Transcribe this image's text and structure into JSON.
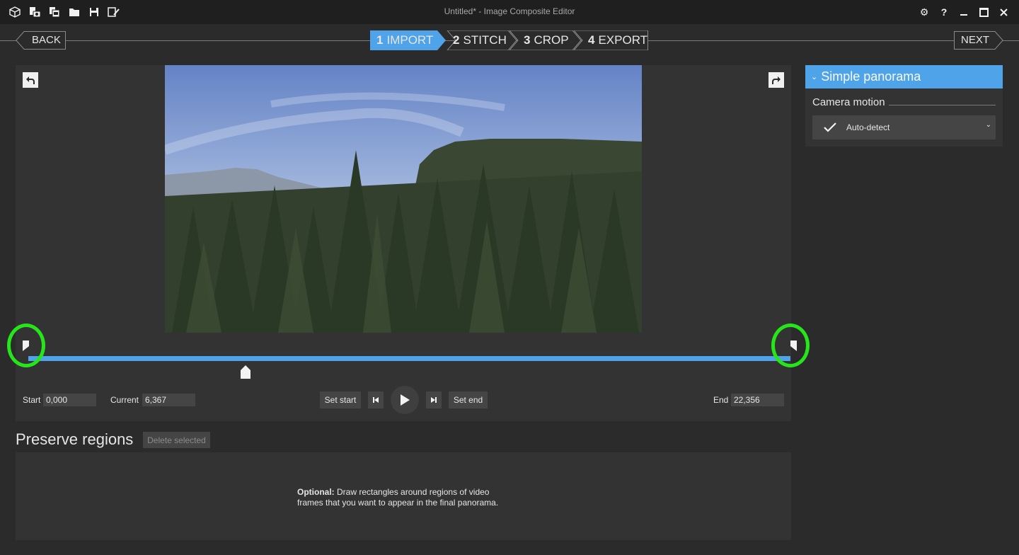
{
  "window": {
    "title": "Untitled* - Image Composite Editor"
  },
  "toolbar_icons": [
    "new-project-icon",
    "new-from-camera-icon",
    "new-from-files-icon",
    "open-folder-icon",
    "save-icon",
    "save-as-icon"
  ],
  "window_controls": {
    "settings": "⚙",
    "help": "?",
    "minimize": "–",
    "maximize": "▢",
    "close": "✕"
  },
  "nav": {
    "back": "BACK",
    "next": "NEXT",
    "steps": [
      {
        "num": "1",
        "label": "IMPORT",
        "active": true
      },
      {
        "num": "2",
        "label": "STITCH",
        "active": false
      },
      {
        "num": "3",
        "label": "CROP",
        "active": false
      },
      {
        "num": "4",
        "label": "EXPORT",
        "active": false
      }
    ]
  },
  "playback": {
    "start_label": "Start",
    "start_value": "0,000",
    "current_label": "Current",
    "current_value": "6,367",
    "end_label": "End",
    "end_value": "22,356",
    "set_start": "Set start",
    "set_end": "Set end",
    "playhead_fraction": 0.285
  },
  "preserve_regions": {
    "title": "Preserve regions",
    "delete_button": "Delete selected",
    "note_bold": "Optional:",
    "note_line1": " Draw rectangles around regions of video",
    "note_line2": "frames that you want to appear in the final panorama."
  },
  "right_panel": {
    "header": "Simple panorama",
    "camera_motion_label": "Camera motion",
    "camera_motion_value": "Auto-detect"
  },
  "colors": {
    "accent": "#4fa3e8",
    "highlight_ring": "#27e51b",
    "background": "#2b2b2b",
    "panel": "#333333"
  }
}
